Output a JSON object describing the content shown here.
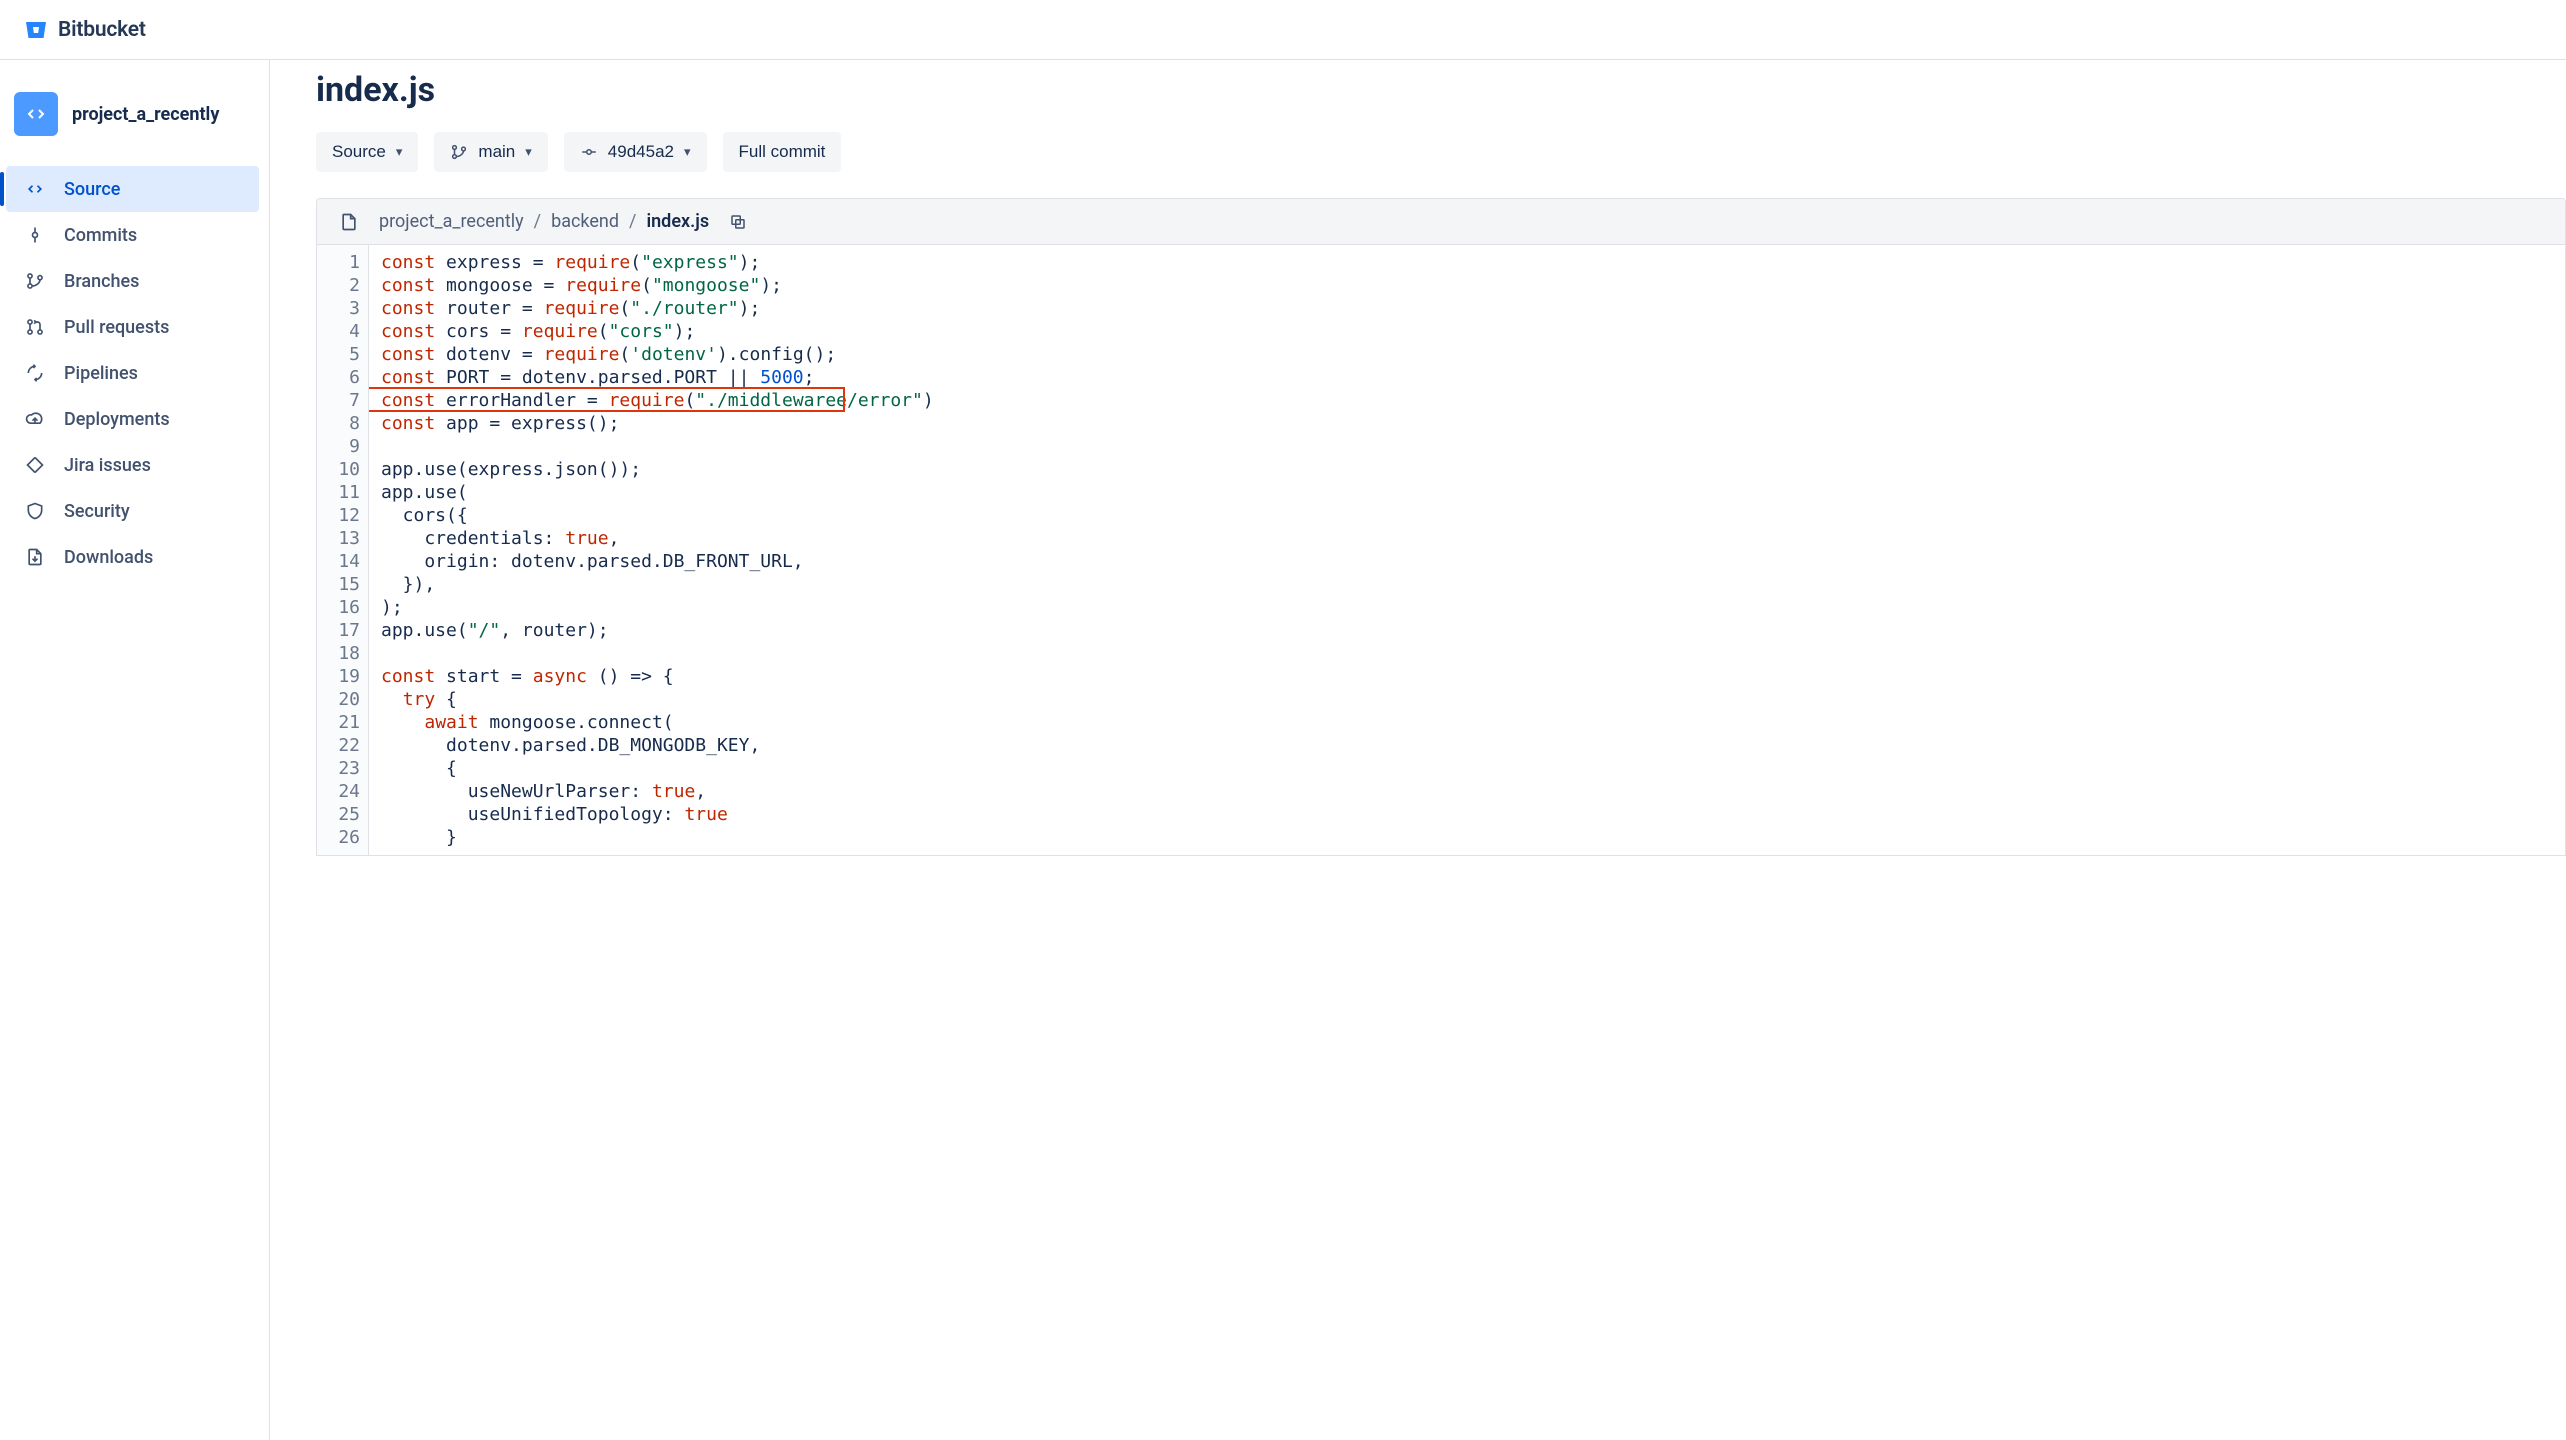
{
  "brand": {
    "name": "Bitbucket"
  },
  "project": {
    "name": "project_a_recently"
  },
  "sidebar": {
    "items": [
      {
        "id": "source",
        "label": "Source",
        "icon": "code-icon",
        "active": true
      },
      {
        "id": "commits",
        "label": "Commits",
        "icon": "commit-icon"
      },
      {
        "id": "branches",
        "label": "Branches",
        "icon": "branch-icon"
      },
      {
        "id": "pull-requests",
        "label": "Pull requests",
        "icon": "pull-request-icon"
      },
      {
        "id": "pipelines",
        "label": "Pipelines",
        "icon": "pipeline-icon"
      },
      {
        "id": "deployments",
        "label": "Deployments",
        "icon": "deploy-icon"
      },
      {
        "id": "jira-issues",
        "label": "Jira issues",
        "icon": "jira-icon"
      },
      {
        "id": "security",
        "label": "Security",
        "icon": "shield-icon"
      },
      {
        "id": "downloads",
        "label": "Downloads",
        "icon": "download-icon"
      }
    ]
  },
  "page": {
    "title": "index.js"
  },
  "toolbar": {
    "source_label": "Source",
    "branch_label": "main",
    "commit_label": "49d45a2",
    "full_commit_label": "Full commit"
  },
  "breadcrumb": {
    "segments": [
      "project_a_recently",
      "backend",
      "index.js"
    ]
  },
  "highlight": {
    "line": 7
  },
  "code": {
    "lines": [
      [
        {
          "t": "kw",
          "v": "const"
        },
        {
          "t": "id",
          "v": " express = "
        },
        {
          "t": "fn",
          "v": "require"
        },
        {
          "t": "id",
          "v": "("
        },
        {
          "t": "str",
          "v": "\"express\""
        },
        {
          "t": "id",
          "v": ");"
        }
      ],
      [
        {
          "t": "kw",
          "v": "const"
        },
        {
          "t": "id",
          "v": " mongoose = "
        },
        {
          "t": "fn",
          "v": "require"
        },
        {
          "t": "id",
          "v": "("
        },
        {
          "t": "str",
          "v": "\"mongoose\""
        },
        {
          "t": "id",
          "v": ");"
        }
      ],
      [
        {
          "t": "kw",
          "v": "const"
        },
        {
          "t": "id",
          "v": " router = "
        },
        {
          "t": "fn",
          "v": "require"
        },
        {
          "t": "id",
          "v": "("
        },
        {
          "t": "str",
          "v": "\"./router\""
        },
        {
          "t": "id",
          "v": ");"
        }
      ],
      [
        {
          "t": "kw",
          "v": "const"
        },
        {
          "t": "id",
          "v": " cors = "
        },
        {
          "t": "fn",
          "v": "require"
        },
        {
          "t": "id",
          "v": "("
        },
        {
          "t": "str",
          "v": "\"cors\""
        },
        {
          "t": "id",
          "v": ");"
        }
      ],
      [
        {
          "t": "kw",
          "v": "const"
        },
        {
          "t": "id",
          "v": " dotenv = "
        },
        {
          "t": "fn",
          "v": "require"
        },
        {
          "t": "id",
          "v": "("
        },
        {
          "t": "str",
          "v": "'dotenv'"
        },
        {
          "t": "id",
          "v": ").config();"
        }
      ],
      [
        {
          "t": "kw",
          "v": "const"
        },
        {
          "t": "id",
          "v": " PORT = dotenv.parsed.PORT || "
        },
        {
          "t": "num",
          "v": "5000"
        },
        {
          "t": "id",
          "v": ";"
        }
      ],
      [
        {
          "t": "kw",
          "v": "const"
        },
        {
          "t": "id",
          "v": " errorHandler = "
        },
        {
          "t": "fn",
          "v": "require"
        },
        {
          "t": "id",
          "v": "("
        },
        {
          "t": "str",
          "v": "\"./middlewaree/error\""
        },
        {
          "t": "id",
          "v": ")"
        }
      ],
      [
        {
          "t": "kw",
          "v": "const"
        },
        {
          "t": "id",
          "v": " app = express();"
        }
      ],
      [],
      [
        {
          "t": "id",
          "v": "app.use(express.json());"
        }
      ],
      [
        {
          "t": "id",
          "v": "app.use("
        }
      ],
      [
        {
          "t": "id",
          "v": "  cors({"
        }
      ],
      [
        {
          "t": "id",
          "v": "    credentials: "
        },
        {
          "t": "bool",
          "v": "true"
        },
        {
          "t": "id",
          "v": ","
        }
      ],
      [
        {
          "t": "id",
          "v": "    origin: dotenv.parsed.DB_FRONT_URL,"
        }
      ],
      [
        {
          "t": "id",
          "v": "  }),"
        }
      ],
      [
        {
          "t": "id",
          "v": ");"
        }
      ],
      [
        {
          "t": "id",
          "v": "app.use("
        },
        {
          "t": "str",
          "v": "\"/\""
        },
        {
          "t": "id",
          "v": ", router);"
        }
      ],
      [],
      [
        {
          "t": "kw",
          "v": "const"
        },
        {
          "t": "id",
          "v": " start = "
        },
        {
          "t": "kw",
          "v": "async"
        },
        {
          "t": "id",
          "v": " () => {"
        }
      ],
      [
        {
          "t": "id",
          "v": "  "
        },
        {
          "t": "kw",
          "v": "try"
        },
        {
          "t": "id",
          "v": " {"
        }
      ],
      [
        {
          "t": "id",
          "v": "    "
        },
        {
          "t": "kw",
          "v": "await"
        },
        {
          "t": "id",
          "v": " mongoose.connect("
        }
      ],
      [
        {
          "t": "id",
          "v": "      dotenv.parsed.DB_MONGODB_KEY,"
        }
      ],
      [
        {
          "t": "id",
          "v": "      {"
        }
      ],
      [
        {
          "t": "id",
          "v": "        useNewUrlParser: "
        },
        {
          "t": "bool",
          "v": "true"
        },
        {
          "t": "id",
          "v": ","
        }
      ],
      [
        {
          "t": "id",
          "v": "        useUnifiedTopology: "
        },
        {
          "t": "bool",
          "v": "true"
        }
      ],
      [
        {
          "t": "id",
          "v": "      }"
        }
      ]
    ]
  }
}
